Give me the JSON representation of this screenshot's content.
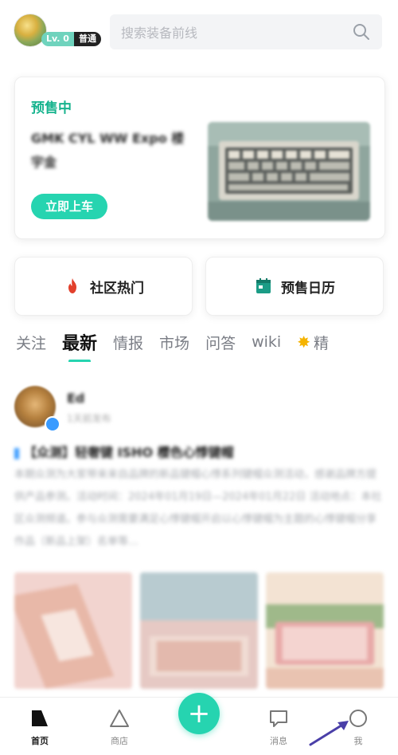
{
  "header": {
    "level": "Lv. 0",
    "tier": "普通",
    "search_placeholder": "搜索装备前线"
  },
  "presale": {
    "tag": "预售中",
    "title": "GMK CYL WW Expo 楼宇金",
    "cta": "立即上车"
  },
  "quick_links": [
    {
      "label": "社区热门",
      "icon": "flame-icon"
    },
    {
      "label": "预售日历",
      "icon": "calendar-icon"
    }
  ],
  "tabs": [
    {
      "label": "关注"
    },
    {
      "label": "最新",
      "active": true
    },
    {
      "label": "情报"
    },
    {
      "label": "市场"
    },
    {
      "label": "问答"
    },
    {
      "label": "wiki"
    },
    {
      "label": "精",
      "icon": "sparkle-icon"
    }
  ],
  "post": {
    "username": "Ed",
    "time": "1天前发布",
    "title": "【众测】轻奢键 ISHO 樱色心悸键帽",
    "body": "本期众测为大家带来来自品牌的新品键帽心悸系列键帽众测活动，感谢品牌方提供产品参测。活动时间：2024年01月19日—2024年01月22日 活动地点：本社区众测频道。参与众测需要满足心悸键帽开启以心悸键帽为主题的心悸键帽分享作品（新品上架）名单等…"
  },
  "bottom_nav": [
    {
      "label": "首页",
      "icon": "home-icon",
      "active": true
    },
    {
      "label": "商店",
      "icon": "store-icon"
    },
    {
      "label": "",
      "icon": "plus-icon"
    },
    {
      "label": "消息",
      "icon": "message-icon"
    },
    {
      "label": "我",
      "icon": "profile-icon"
    }
  ],
  "colors": {
    "accent": "#26d4b0",
    "accent_text": "#17b38e",
    "verify": "#3a9bff",
    "annotation_arrow": "#4a3fa8"
  }
}
